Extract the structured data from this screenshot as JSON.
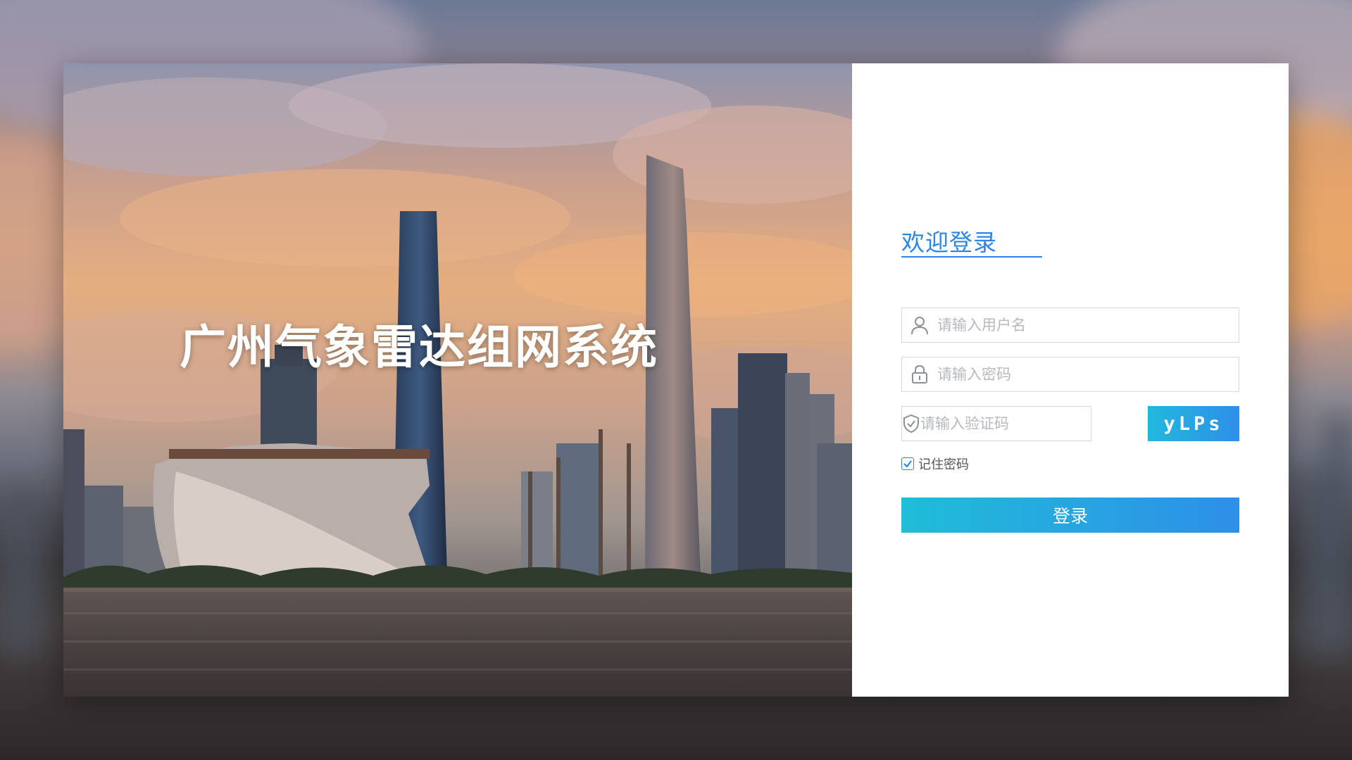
{
  "system_title": "广州气象雷达组网系统",
  "login": {
    "welcome": "欢迎登录",
    "username": {
      "placeholder": "请输入用户名",
      "value": "",
      "icon": "user-icon"
    },
    "password": {
      "placeholder": "请输入密码",
      "value": "",
      "icon": "lock-icon"
    },
    "captcha": {
      "placeholder": "请输入验证码",
      "value": "",
      "icon": "shield-check-icon",
      "code": "yLPs"
    },
    "remember": {
      "label": "记住密码",
      "checked": true
    },
    "submit_label": "登录"
  },
  "colors": {
    "accent": "#2b86e6",
    "button_gradient": [
      "#1fbdd8",
      "#2e8fe8"
    ]
  }
}
